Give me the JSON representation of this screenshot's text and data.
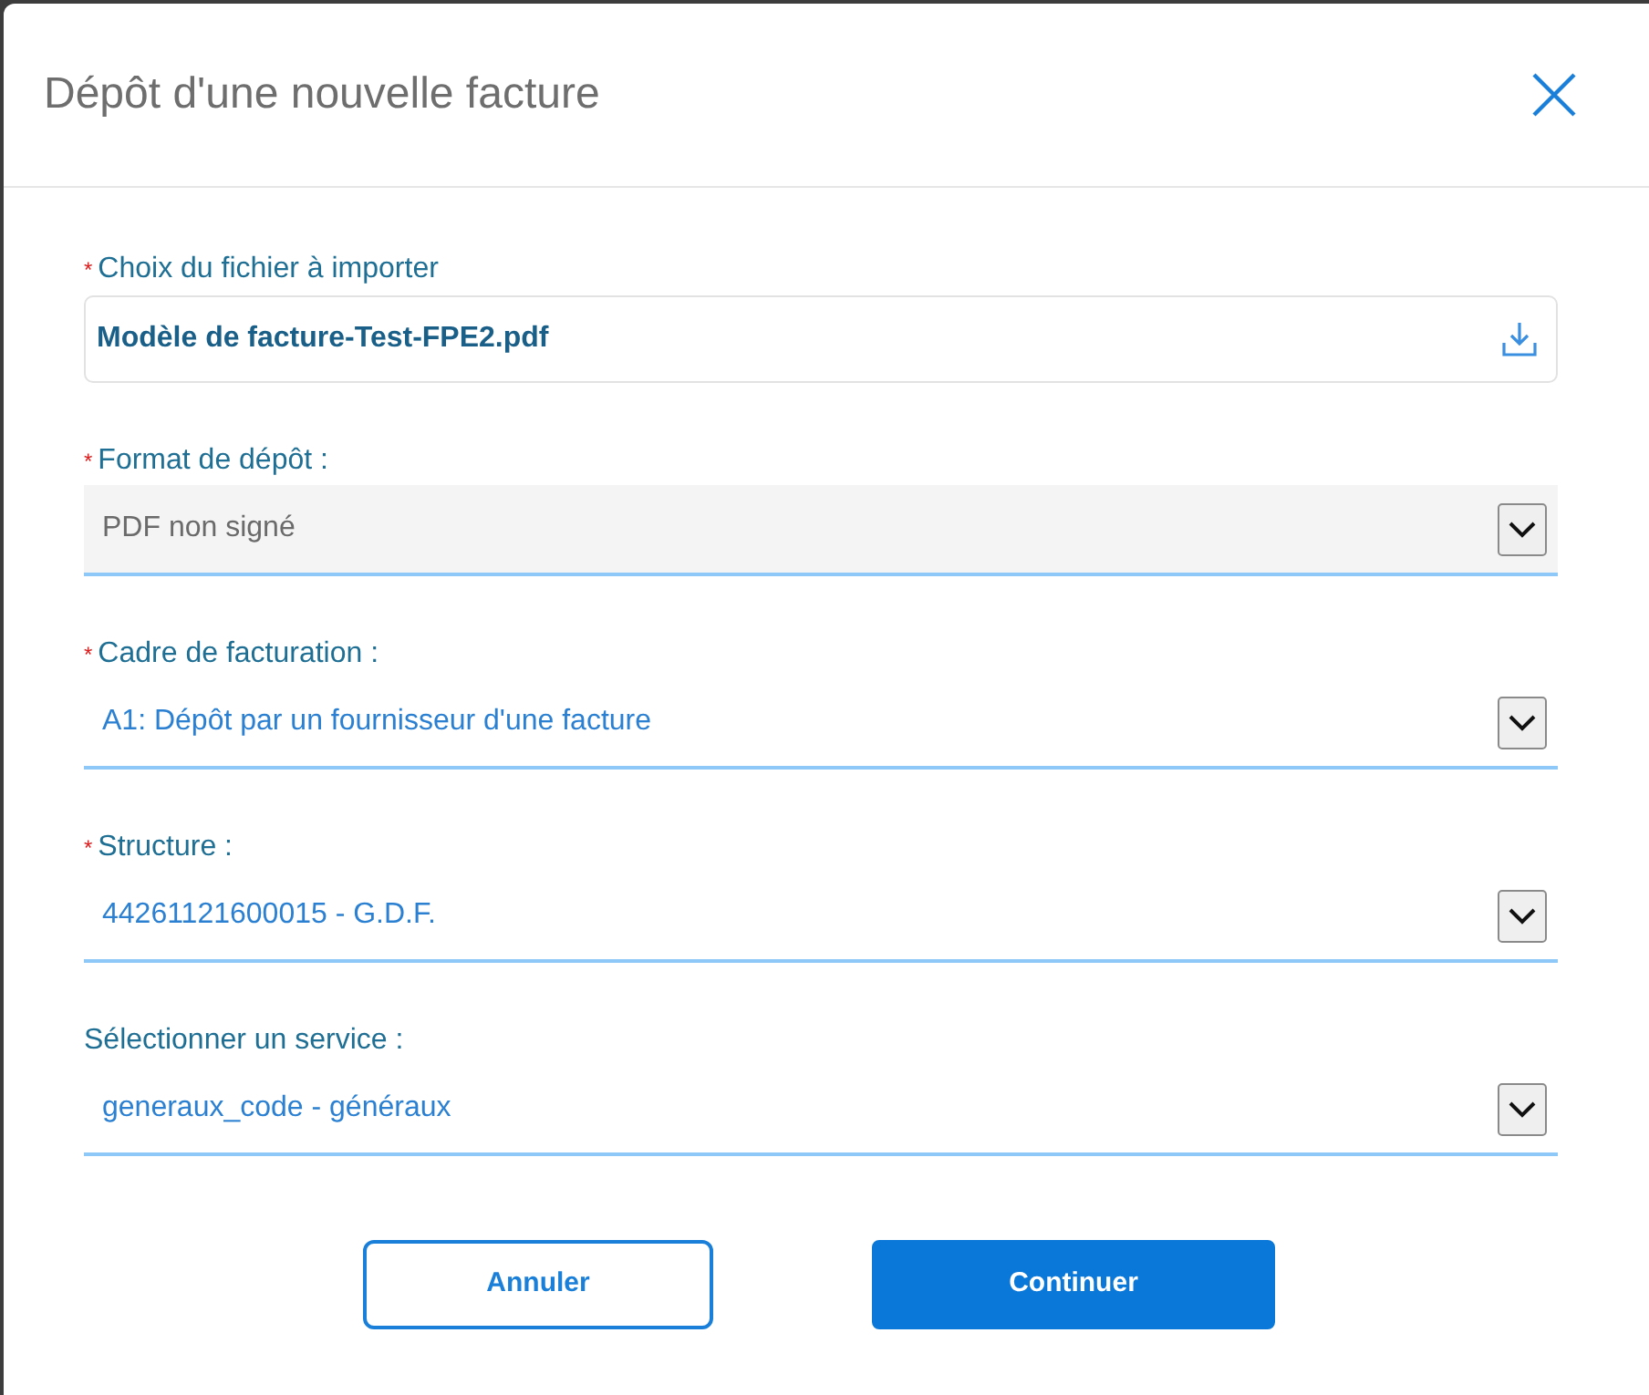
{
  "dialog": {
    "title": "Dépôt d'une nouvelle facture"
  },
  "fields": [
    {
      "kind": "file",
      "required_mark": "*",
      "label": "Choix du fichier à importer",
      "value": "Modèle de facture-Test-FPE2.pdf"
    },
    {
      "kind": "select",
      "required_mark": "*",
      "label": "Format de dépôt :",
      "value": "PDF non signé",
      "disabled": true
    },
    {
      "kind": "select",
      "required_mark": "*",
      "label": "Cadre de facturation :",
      "value": "A1: Dépôt par un fournisseur d'une facture",
      "disabled": false
    },
    {
      "kind": "select",
      "required_mark": "*",
      "label": "Structure :",
      "value": "44261121600015 - G.D.F.",
      "disabled": false
    },
    {
      "kind": "select",
      "label": "Sélectionner un service :",
      "value": "generaux_code - généraux",
      "disabled": false
    }
  ],
  "buttons": [
    {
      "kind": "secondary",
      "label": "Annuler"
    },
    {
      "kind": "primary",
      "label": "Continuer"
    }
  ]
}
